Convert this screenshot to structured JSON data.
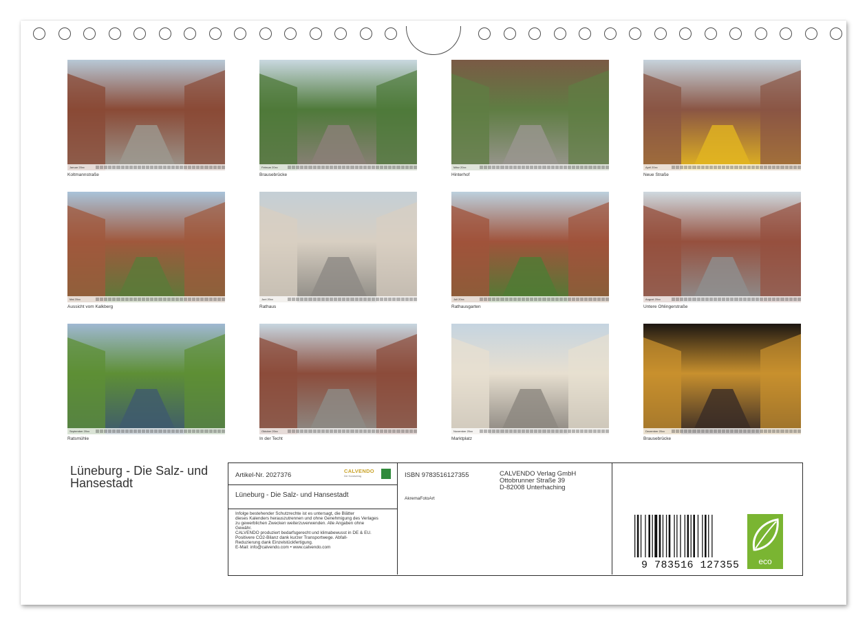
{
  "photos": [
    {
      "month": "Januar 20xx",
      "caption": "Koltmannstraße",
      "colors": [
        "#b7c8d6",
        "#8a4a36",
        "#9c9890"
      ]
    },
    {
      "month": "Februar 20xx",
      "caption": "Brausebrücke",
      "colors": [
        "#c9d8e0",
        "#4f7a3a",
        "#8b8078"
      ]
    },
    {
      "month": "März 20xx",
      "caption": "Hinterhof",
      "colors": [
        "#7a5a45",
        "#5f7d43",
        "#9a9690"
      ]
    },
    {
      "month": "April 20xx",
      "caption": "Neue Straße",
      "colors": [
        "#c6d3dc",
        "#8a5544",
        "#e2b520"
      ]
    },
    {
      "month": "Mai 20xx",
      "caption": "Aussicht vom Kalkberg",
      "colors": [
        "#a9c3d9",
        "#a0583c",
        "#5b7a3a"
      ]
    },
    {
      "month": "Juni 20xx",
      "caption": "Rathaus",
      "colors": [
        "#c4cfd6",
        "#d8cfc2",
        "#8d8a84"
      ]
    },
    {
      "month": "Juli 20xx",
      "caption": "Rathausgarten",
      "colors": [
        "#bcd0dd",
        "#a0533b",
        "#4f7c35"
      ]
    },
    {
      "month": "August 20xx",
      "caption": "Untere Ohlingerstraße",
      "colors": [
        "#cfd9df",
        "#96503e",
        "#8e8e8e"
      ]
    },
    {
      "month": "September 20xx",
      "caption": "Ratsmühle",
      "colors": [
        "#9fb8d2",
        "#5e8f35",
        "#3e5a6e"
      ]
    },
    {
      "month": "Oktober 20xx",
      "caption": "In der Techt",
      "colors": [
        "#c7d6e0",
        "#8c4c3b",
        "#8d8b86"
      ]
    },
    {
      "month": "November 20xx",
      "caption": "Marktplatz",
      "colors": [
        "#c5d4e0",
        "#e7dfd0",
        "#8c8780"
      ]
    },
    {
      "month": "Dezember 20xx",
      "caption": "Brausebrücke",
      "colors": [
        "#1c1612",
        "#c8902e",
        "#3a2c26"
      ]
    }
  ],
  "title": "Lüneburg - Die Salz- und Hansestadt",
  "info": {
    "artikel": "Artikel-Nr. 2027376",
    "logo_word": "CALVENDO",
    "logo_sub": "Der Kunstverlag",
    "subtitle": "Lüneburg - Die Salz- und Hansestadt",
    "legal": [
      "Infolge bestehender Schutzrechte ist es untersagt, die Blätter",
      "dieses Kalenders herauszutrennen und ohne Genehmigung des Verlages",
      "zu gewerblichen Zwecken weiterzuverwenden. Alle Angaben ohne",
      "Gewähr.",
      "CALVENDO produziert bedarfsgerecht und klimabewusst in DE & EU.",
      "Positivere CO2-Bilanz dank kurzer Transportwege. Abfall-",
      "Reduzierung dank Einzelstückfertigung.",
      "E-Mail: info@calvendo.com • www.calvendo.com"
    ],
    "isbn": "ISBN 9783516127355",
    "publisher_lines": [
      "CALVENDO Verlag GmbH",
      "Ottobrunner Straße 39",
      "D-82008 Unterhaching"
    ],
    "author": "AkremaFotoArt",
    "barcode_number": "9 783516 127355",
    "eco_label": "eco"
  }
}
